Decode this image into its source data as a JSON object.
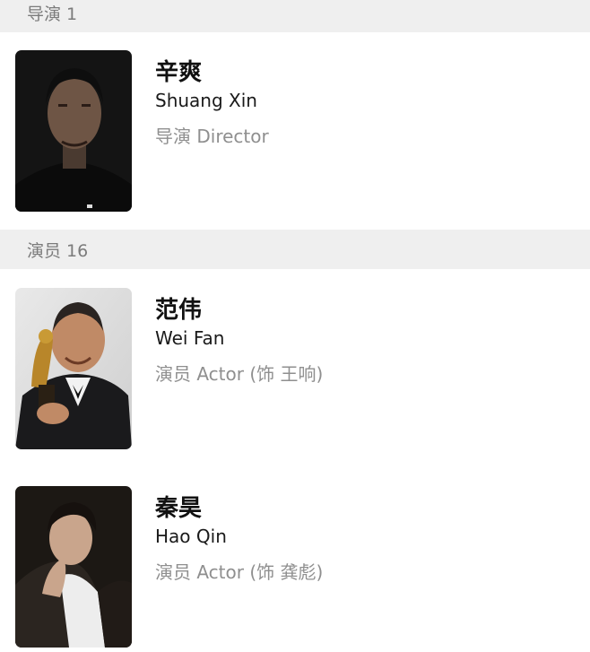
{
  "sections": {
    "director": {
      "title": "导演 1"
    },
    "cast": {
      "title": "演员 16"
    }
  },
  "people": [
    {
      "name_cn": "辛爽",
      "name_en": "Shuang Xin",
      "role": "导演 Director"
    },
    {
      "name_cn": "范伟",
      "name_en": "Wei Fan",
      "role": "演员 Actor (饰 王响)"
    },
    {
      "name_cn": "秦昊",
      "name_en": "Hao Qin",
      "role": "演员 Actor (饰 龚彪)"
    }
  ]
}
